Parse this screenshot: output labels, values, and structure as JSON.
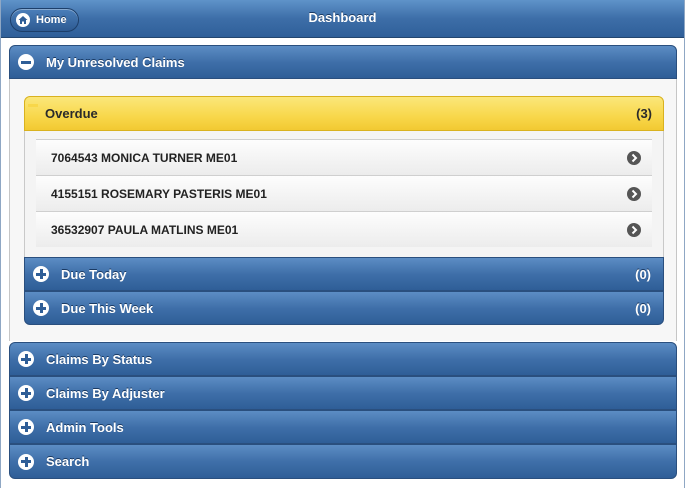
{
  "header": {
    "home_label": "Home",
    "title": "Dashboard"
  },
  "sections": {
    "unresolved": {
      "label": "My Unresolved Claims",
      "overdue": {
        "label": "Overdue",
        "count": "(3)",
        "items": [
          "7064543 MONICA TURNER ME01",
          "4155151 ROSEMARY PASTERIS ME01",
          "36532907 PAULA MATLINS ME01"
        ]
      },
      "due_today": {
        "label": "Due Today",
        "count": "(0)"
      },
      "due_this_week": {
        "label": "Due This Week",
        "count": "(0)"
      }
    },
    "claims_by_status": {
      "label": "Claims By Status"
    },
    "claims_by_adjuster": {
      "label": "Claims By Adjuster"
    },
    "admin_tools": {
      "label": "Admin Tools"
    },
    "search": {
      "label": "Search"
    }
  },
  "colors": {
    "header_blue": "#3d6ea8",
    "overdue_yellow": "#f8d74a"
  }
}
